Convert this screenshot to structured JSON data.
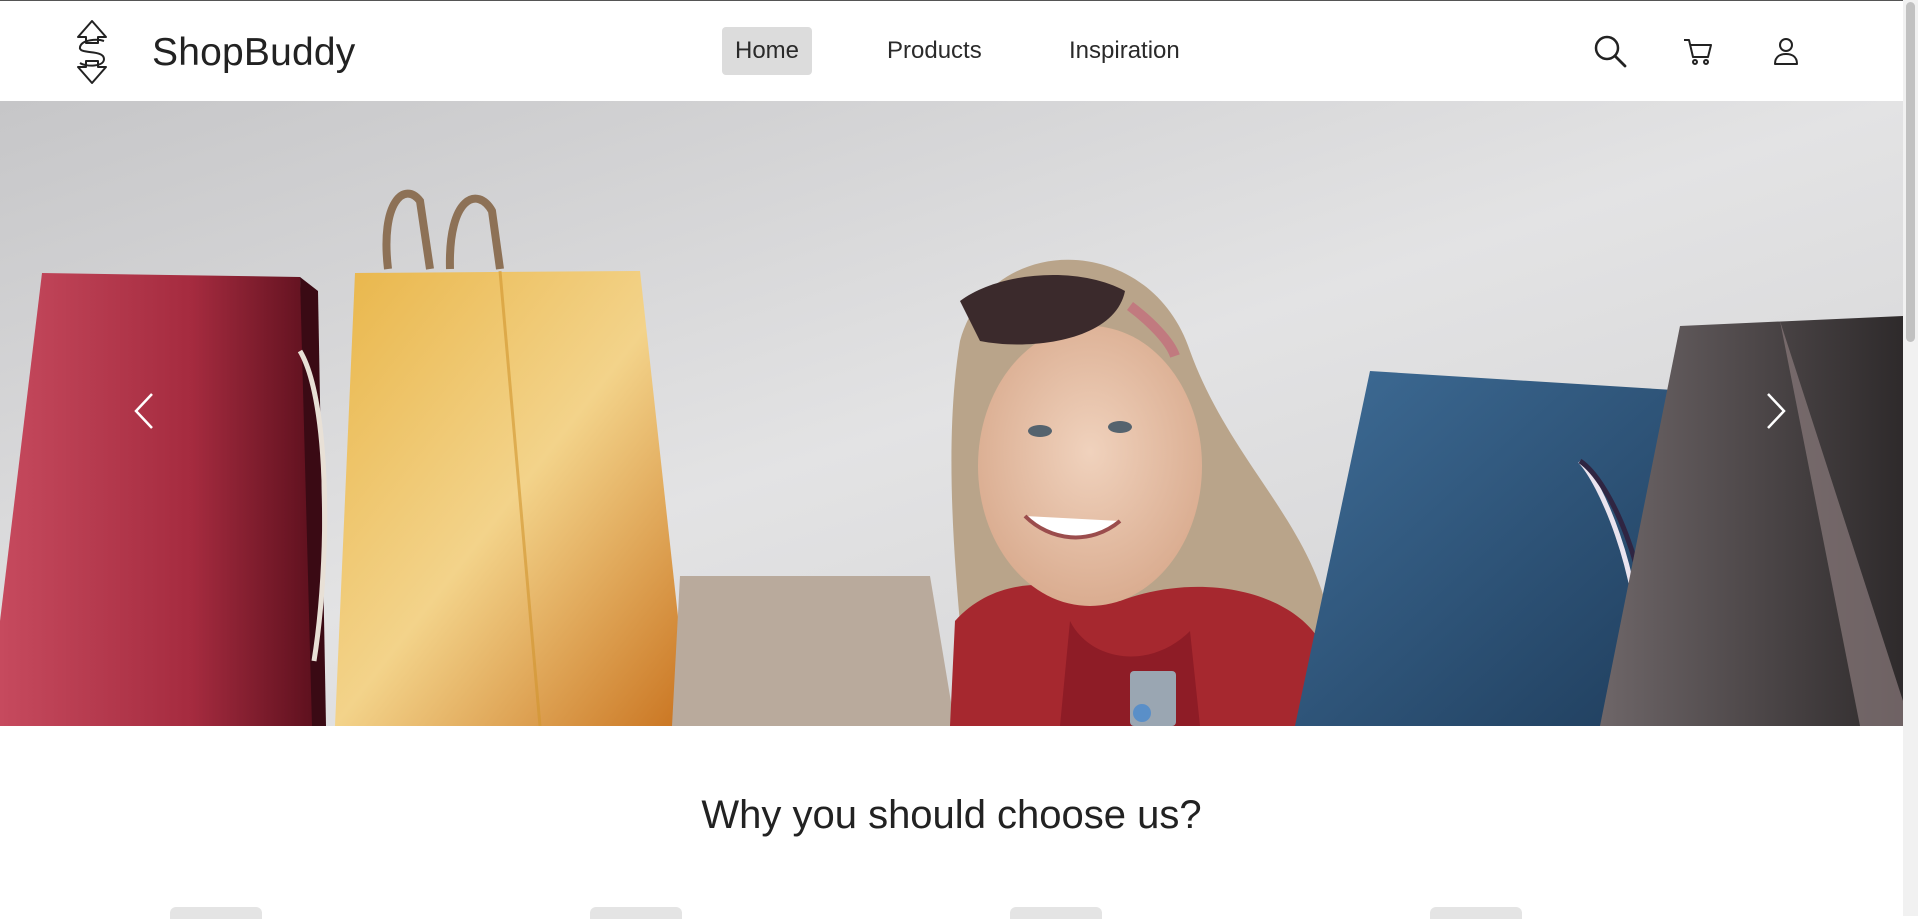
{
  "brand": {
    "name": "ShopBuddy",
    "logo_icon": "dollar-arrows-logo"
  },
  "nav": {
    "links": [
      {
        "label": "Home",
        "active": true
      },
      {
        "label": "Products",
        "active": false
      },
      {
        "label": "Inspiration",
        "active": false
      }
    ],
    "icons": [
      "search-icon",
      "cart-icon",
      "user-icon"
    ]
  },
  "hero": {
    "image": "woman-shopping-online-with-bags",
    "prev_icon": "chevron-left-icon",
    "next_icon": "chevron-right-icon"
  },
  "features": {
    "title": "Why you should choose us?",
    "card_count": 4
  },
  "colors": {
    "active_nav_bg": "#dcdcdc",
    "text": "#222222",
    "background": "#ffffff"
  }
}
